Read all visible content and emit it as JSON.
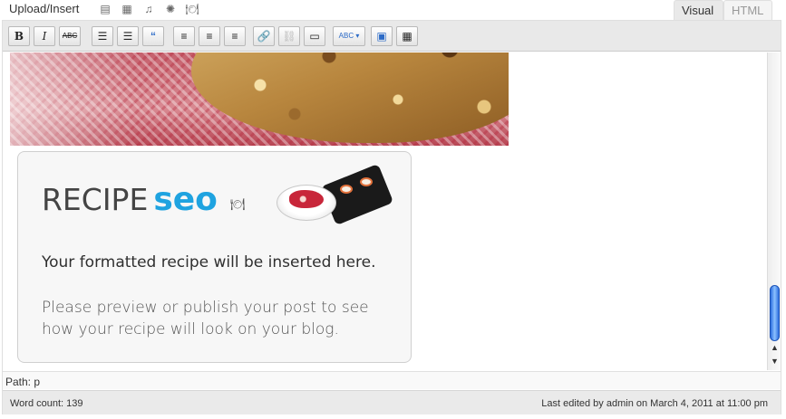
{
  "media_bar": {
    "label": "Upload/Insert",
    "icons": [
      "image-icon",
      "video-icon",
      "audio-icon",
      "media-icon",
      "recipe-icon"
    ]
  },
  "tabs": [
    {
      "label": "Visual",
      "active": true
    },
    {
      "label": "HTML",
      "active": false
    }
  ],
  "toolbar": {
    "bold": "B",
    "italic": "I",
    "strikethrough": "ABC",
    "bullet_list": "☰",
    "numbered_list": "☰",
    "blockquote": "“",
    "align_left": "≡",
    "align_center": "≡",
    "align_right": "≡",
    "link": "🔗",
    "unlink": "⛓",
    "more": "▭",
    "spellcheck": "ABC",
    "fullscreen": "▣",
    "kitchen_sink": "▦"
  },
  "recipe_card": {
    "logo_word": "RECIPE",
    "logo_seo": "seo",
    "line1": "Your formatted recipe will be inserted here.",
    "line2": "Please preview or publish your post to see how your recipe will look on your blog."
  },
  "path": "Path: p",
  "status": {
    "word_count": "Word count: 139",
    "last_edited": "Last edited by admin on March 4, 2011 at 11:00 pm"
  },
  "colors": {
    "accent_blue": "#1fa3e0",
    "scroll_blue": "#2d6fe0"
  }
}
